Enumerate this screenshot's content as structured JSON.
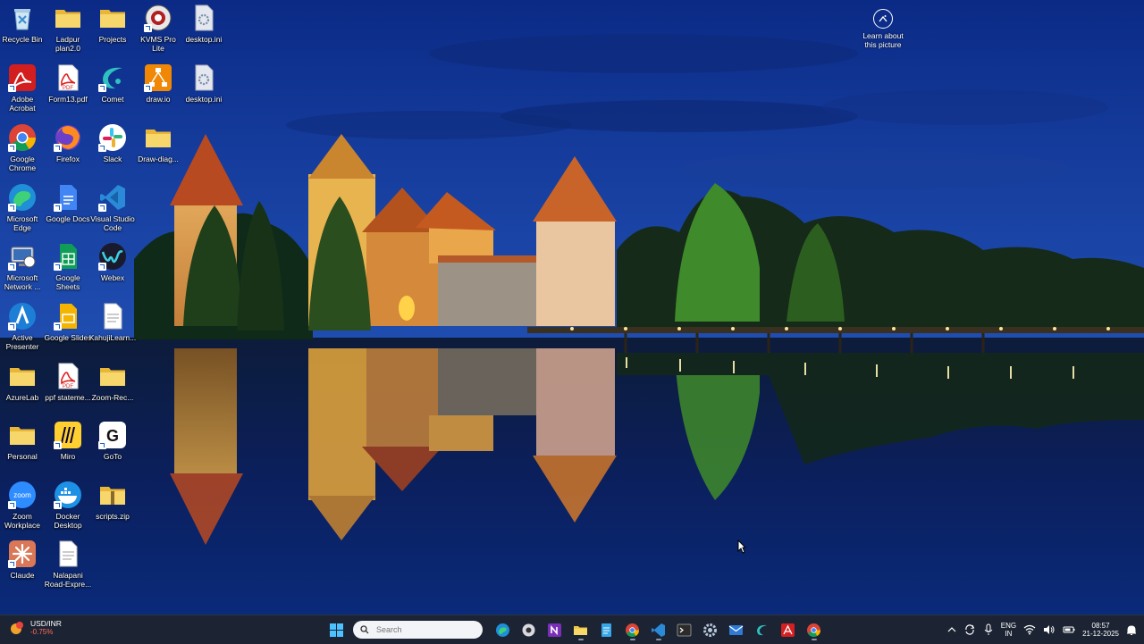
{
  "desktop": {
    "col1": [
      {
        "label": "Recycle Bin",
        "icon": "recycle-bin-icon"
      },
      {
        "label": "Adobe Acrobat",
        "icon": "adobe-acrobat-icon"
      },
      {
        "label": "Google Chrome",
        "icon": "chrome-icon"
      },
      {
        "label": "Microsoft Edge",
        "icon": "edge-icon"
      },
      {
        "label": "Microsoft Network ...",
        "icon": "network-icon"
      },
      {
        "label": "Active Presenter",
        "icon": "active-presenter-icon"
      },
      {
        "label": "AzureLab",
        "icon": "folder-icon"
      },
      {
        "label": "Personal",
        "icon": "folder-icon"
      },
      {
        "label": "Zoom Workplace",
        "icon": "zoom-icon"
      },
      {
        "label": "Claude",
        "icon": "claude-icon"
      }
    ],
    "col2": [
      {
        "label": "Ladpur plan2.0",
        "icon": "folder-icon"
      },
      {
        "label": "Form13.pdf",
        "icon": "pdf-icon"
      },
      {
        "label": "Firefox",
        "icon": "firefox-icon"
      },
      {
        "label": "Google Docs",
        "icon": "google-docs-icon"
      },
      {
        "label": "Google Sheets",
        "icon": "google-sheets-icon"
      },
      {
        "label": "Google Slides",
        "icon": "google-slides-icon"
      },
      {
        "label": "ppf stateme...",
        "icon": "pdf-icon"
      },
      {
        "label": "Miro",
        "icon": "miro-icon"
      },
      {
        "label": "Docker Desktop",
        "icon": "docker-icon"
      },
      {
        "label": "Nalapani Road-Expre...",
        "icon": "document-icon"
      }
    ],
    "col3": [
      {
        "label": "Projects",
        "icon": "folder-icon"
      },
      {
        "label": "Comet",
        "icon": "comet-icon"
      },
      {
        "label": "Slack",
        "icon": "slack-icon"
      },
      {
        "label": "Visual Studio Code",
        "icon": "vscode-icon"
      },
      {
        "label": "Webex",
        "icon": "webex-icon"
      },
      {
        "label": "KahujiLearn...",
        "icon": "document-icon"
      },
      {
        "label": "Zoom-Rec...",
        "icon": "folder-icon"
      },
      {
        "label": "GoTo",
        "icon": "goto-icon"
      },
      {
        "label": "scripts.zip",
        "icon": "zip-folder-icon"
      }
    ],
    "col4": [
      {
        "label": "KVMS Pro Lite",
        "icon": "kvms-icon"
      },
      {
        "label": "draw.io",
        "icon": "drawio-icon"
      },
      {
        "label": "Draw-diag...",
        "icon": "folder-icon"
      }
    ],
    "col5": [
      {
        "label": "desktop.ini",
        "icon": "settings-file-icon"
      },
      {
        "label": "desktop.ini",
        "icon": "settings-file-icon"
      }
    ],
    "learn": {
      "label": "Learn about this picture",
      "icon": "learn-picture-icon"
    }
  },
  "taskbar": {
    "widget": {
      "title": "USD/INR",
      "value": "-0.75%",
      "value_color": "#ff6a5a"
    },
    "search_placeholder": "Search",
    "apps": [
      "start-icon",
      "search",
      "edge-icon",
      "media-icon",
      "onenote-icon",
      "file-explorer-icon",
      "notepad-icon",
      "chrome-icon",
      "vscode-icon",
      "terminal-icon",
      "settings-icon",
      "mail-icon",
      "comet-icon",
      "adobe-acrobat-icon",
      "chrome-profile-icon"
    ],
    "tray": {
      "language_line1": "ENG",
      "language_line2": "IN",
      "time": "08:57",
      "date": "21-12-2025"
    }
  }
}
